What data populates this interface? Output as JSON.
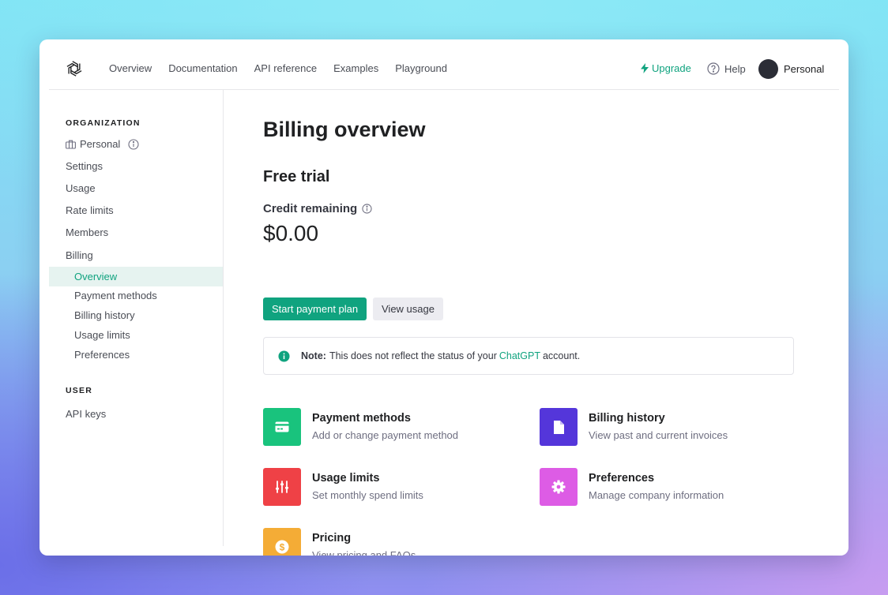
{
  "nav": {
    "links": [
      "Overview",
      "Documentation",
      "API reference",
      "Examples",
      "Playground"
    ],
    "upgrade": "Upgrade",
    "help": "Help",
    "profile": "Personal"
  },
  "sidebar": {
    "org_heading": "ORGANIZATION",
    "org_name": "Personal",
    "items": [
      "Settings",
      "Usage",
      "Rate limits",
      "Members",
      "Billing"
    ],
    "billing_sub": [
      "Overview",
      "Payment methods",
      "Billing history",
      "Usage limits",
      "Preferences"
    ],
    "active_sub": "Overview",
    "user_heading": "USER",
    "user_items": [
      "API keys"
    ]
  },
  "main": {
    "title": "Billing overview",
    "plan_title": "Free trial",
    "credit_label": "Credit remaining",
    "credit_amount": "$0.00",
    "primary_button": "Start payment plan",
    "secondary_button": "View usage",
    "note": {
      "label": "Note:",
      "text_before": "This does not reflect the status of your",
      "link": "ChatGPT",
      "text_after": "account."
    },
    "cards": [
      {
        "title": "Payment methods",
        "desc": "Add or change payment method",
        "color": "#19c37d",
        "icon": "credit-card-icon"
      },
      {
        "title": "Billing history",
        "desc": "View past and current invoices",
        "color": "#5436da",
        "icon": "document-icon"
      },
      {
        "title": "Usage limits",
        "desc": "Set monthly spend limits",
        "color": "#ef4146",
        "icon": "sliders-icon"
      },
      {
        "title": "Preferences",
        "desc": "Manage company information",
        "color": "#dd5ce5",
        "icon": "gear-icon"
      },
      {
        "title": "Pricing",
        "desc": "View pricing and FAQs",
        "color": "#f4ac36",
        "icon": "dollar-icon"
      }
    ]
  },
  "colors": {
    "accent": "#10a37f",
    "active_bg": "#e6f3f0"
  }
}
